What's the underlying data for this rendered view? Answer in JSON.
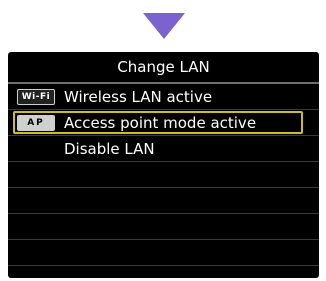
{
  "screen": {
    "title": "Change LAN",
    "items": [
      {
        "badge": "Wi-Fi",
        "icon": "wifi-badge-icon",
        "label": "Wireless LAN active",
        "selected": false
      },
      {
        "badge": "AP",
        "icon": "ap-badge-icon",
        "label": "Access point mode active",
        "selected": true
      },
      {
        "badge": "",
        "icon": "",
        "label": "Disable LAN",
        "selected": false
      }
    ],
    "empty_rows": 4
  },
  "colors": {
    "arrow": "#7b63cf",
    "screen_bg": "#000000",
    "selection_border": "#cdbf22",
    "text": "#ffffff"
  }
}
